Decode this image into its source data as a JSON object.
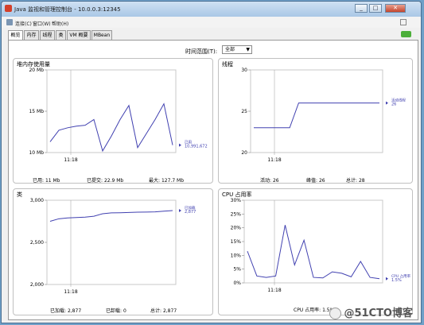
{
  "window": {
    "title": "Java 监视和管理控制台 - 10.0.0.3:12345",
    "min_label": "_",
    "max_label": "□",
    "close_label": "✕"
  },
  "menu": [
    "连接(C)",
    "窗口(W)",
    "帮助(H)"
  ],
  "tabs": [
    "概览",
    "内存",
    "线程",
    "类",
    "VM 概要",
    "MBean"
  ],
  "active_tab": 0,
  "time_range": {
    "label": "时间范围(T):",
    "value": "全部"
  },
  "watermark": "@51CTO博客",
  "panels": {
    "heap": {
      "title": "堆内存使用量",
      "footer": [
        {
          "label": "已用:",
          "value": "11  Mb"
        },
        {
          "label": "已提交:",
          "value": "22.9  Mb"
        },
        {
          "label": "最大:",
          "value": "127.7  Mb"
        }
      ]
    },
    "threads": {
      "title": "线程",
      "footer": [
        {
          "label": "活动:",
          "value": "26"
        },
        {
          "label": "峰值:",
          "value": "26"
        },
        {
          "label": "总计:",
          "value": "28"
        }
      ]
    },
    "classes": {
      "title": "类",
      "footer": [
        {
          "label": "已加载:",
          "value": "2,877"
        },
        {
          "label": "已卸载:",
          "value": "0"
        },
        {
          "label": "总计:",
          "value": "2,877"
        }
      ]
    },
    "cpu": {
      "title": "CPU 占用率",
      "footer": [
        {
          "label": "CPU 占用率:",
          "value": "1.5%"
        }
      ]
    }
  },
  "chart_data": [
    {
      "id": "heap",
      "type": "line",
      "x_tick": "11:18",
      "y_ticks": [
        "20 Mb",
        "15 Mb",
        "10 Mb"
      ],
      "ylim": [
        10,
        20
      ],
      "series": [
        {
          "name": "已用",
          "value_label": "10,991,672",
          "color": "#4040b0",
          "values": [
            11.3,
            12.7,
            13.0,
            13.2,
            13.3,
            14.0,
            10.2,
            12.0,
            14.0,
            15.7,
            10.6,
            12.3,
            14.0,
            15.9,
            10.9
          ]
        }
      ]
    },
    {
      "id": "threads",
      "type": "line",
      "x_tick": "11:18",
      "y_ticks": [
        "30",
        "25",
        "20"
      ],
      "ylim": [
        20,
        30
      ],
      "series": [
        {
          "name": "活动线程",
          "value_label": "26",
          "color": "#4040b0",
          "values": [
            23,
            23,
            23,
            23,
            23,
            26,
            26,
            26,
            26,
            26,
            26,
            26,
            26,
            26,
            26
          ]
        }
      ]
    },
    {
      "id": "classes",
      "type": "line",
      "x_tick": "11:18",
      "y_ticks": [
        "3,000",
        "2,500",
        "2,000"
      ],
      "ylim": [
        2000,
        3000
      ],
      "series": [
        {
          "name": "已加载",
          "value_label": "2,877",
          "color": "#4040b0",
          "values": [
            2750,
            2780,
            2790,
            2795,
            2800,
            2810,
            2840,
            2850,
            2852,
            2855,
            2858,
            2860,
            2862,
            2870,
            2877
          ]
        }
      ]
    },
    {
      "id": "cpu",
      "type": "line",
      "x_tick": "11:18",
      "y_ticks": [
        "30%",
        "25%",
        "20%",
        "15%",
        "10%",
        "5%",
        "0%"
      ],
      "ylim": [
        0,
        30
      ],
      "series": [
        {
          "name": "CPU 占用率",
          "value_label": "1.5%",
          "color": "#4040b0",
          "values": [
            11.5,
            2.5,
            2,
            2.5,
            21,
            6.5,
            15.5,
            2,
            1.8,
            4,
            3.5,
            2.2,
            7.8,
            2,
            1.5
          ]
        }
      ]
    }
  ]
}
